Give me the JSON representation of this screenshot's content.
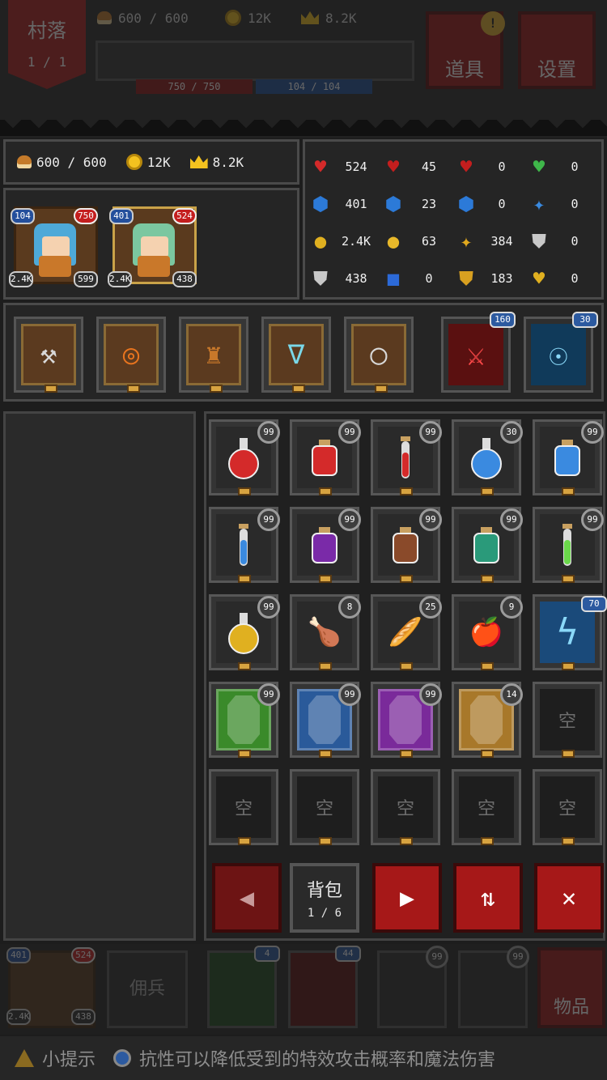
{
  "hud": {
    "location": "村落",
    "location_page": "1 / 1",
    "food": "600 / 600",
    "gold": "12K",
    "fame": "8.2K",
    "hp": "750 / 750",
    "mp": "104 / 104",
    "items_button": "道具",
    "settings_button": "设置",
    "alert_mark": "!"
  },
  "resources": {
    "food": "600 / 600",
    "gold": "12K",
    "fame": "8.2K"
  },
  "heroes": [
    {
      "mp": "104",
      "hp": "750",
      "attack": "2.4K",
      "defense": "599"
    },
    {
      "mp": "401",
      "hp": "524",
      "attack": "2.4K",
      "defense": "438"
    }
  ],
  "stats": [
    {
      "icon": "max-hp-icon",
      "glyph": "♥",
      "color": "#d42a2a",
      "value": "524"
    },
    {
      "icon": "heart-plus-icon",
      "glyph": "♥",
      "color": "#c41e1e",
      "value": "45"
    },
    {
      "icon": "heart-s-icon",
      "glyph": "♥",
      "color": "#c41e1e",
      "value": "0"
    },
    {
      "icon": "green-heart-icon",
      "glyph": "♥",
      "color": "#3fb64a",
      "value": "0"
    },
    {
      "icon": "max-mp-icon",
      "glyph": "⬢",
      "color": "#2c7ad8",
      "value": "401"
    },
    {
      "icon": "mana-plus-icon",
      "glyph": "⬢",
      "color": "#2c7ad8",
      "value": "23"
    },
    {
      "icon": "mana-s-icon",
      "glyph": "⬢",
      "color": "#2c7ad8",
      "value": "0"
    },
    {
      "icon": "blue-star-icon",
      "glyph": "✦",
      "color": "#3a8ae0",
      "value": "0"
    },
    {
      "icon": "attack-potion-icon",
      "glyph": "●",
      "color": "#e0b020",
      "value": "2.4K"
    },
    {
      "icon": "gold-orb-icon",
      "glyph": "●",
      "color": "#e8b82a",
      "value": "63"
    },
    {
      "icon": "gold-star-icon",
      "glyph": "✦",
      "color": "#e0a81e",
      "value": "384"
    },
    {
      "icon": "silver-shield-icon",
      "glyph": "⛊",
      "color": "#c8c8c8",
      "value": "0"
    },
    {
      "icon": "armor-icon",
      "glyph": "⛊",
      "color": "#c8c8c8",
      "value": "438"
    },
    {
      "icon": "blue-gem-icon",
      "glyph": "■",
      "color": "#2c6ad8",
      "value": "0"
    },
    {
      "icon": "gold-shield-icon",
      "glyph": "⛊",
      "color": "#d8a020",
      "value": "183"
    },
    {
      "icon": "gold-heart-badge-icon",
      "glyph": "♥",
      "color": "#e0b020",
      "value": "0"
    }
  ],
  "equipment": [
    {
      "name": "pickaxe-icon",
      "glyph": "⚒",
      "color": "#d8d8d8"
    },
    {
      "name": "round-shield-icon",
      "glyph": "◎",
      "color": "#e8741e"
    },
    {
      "name": "armor-cape-icon",
      "glyph": "♜",
      "color": "#c8782a"
    },
    {
      "name": "necklace-icon",
      "glyph": "∇",
      "color": "#7ad8e8"
    },
    {
      "name": "ring-icon",
      "glyph": "◯",
      "color": "#d8d8d8"
    }
  ],
  "skills": [
    {
      "name": "crossed-swords-skill-icon",
      "glyph": "⚔",
      "color": "#ff4a4a",
      "bg": "#5a1010",
      "level": "160"
    },
    {
      "name": "aura-skill-icon",
      "glyph": "☉",
      "color": "#8ad8f8",
      "bg": "#103a5a",
      "level": "30"
    }
  ],
  "inventory": [
    [
      {
        "name": "red-round-flask-icon",
        "kind": "flask",
        "color": "#d42a2a",
        "count": "99"
      },
      {
        "name": "red-bottle-icon",
        "kind": "bottle",
        "color": "#d42a2a",
        "count": "99"
      },
      {
        "name": "red-vial-icon",
        "kind": "vial",
        "color": "#d42a2a",
        "count": "99"
      },
      {
        "name": "blue-round-flask-icon",
        "kind": "flask",
        "color": "#3a8ae0",
        "count": "30"
      },
      {
        "name": "blue-bottle-icon",
        "kind": "bottle",
        "color": "#3a8ae0",
        "count": "99"
      }
    ],
    [
      {
        "name": "blue-vial-icon",
        "kind": "vial",
        "color": "#3a8ae0",
        "count": "99"
      },
      {
        "name": "purple-bottle-icon",
        "kind": "bottle",
        "color": "#7a2aa8",
        "count": "99"
      },
      {
        "name": "brown-bottle-icon",
        "kind": "bottle",
        "color": "#8a4a2a",
        "count": "99"
      },
      {
        "name": "teal-bottle-icon",
        "kind": "bottle",
        "color": "#2a9a7a",
        "count": "99"
      },
      {
        "name": "green-vial-icon",
        "kind": "vial",
        "color": "#6ad84a",
        "count": "99"
      }
    ],
    [
      {
        "name": "yellow-round-flask-icon",
        "kind": "flask",
        "color": "#e0b020",
        "count": "99"
      },
      {
        "name": "drumstick-icon",
        "kind": "glyph",
        "glyph": "🍗",
        "color": "#c8782a",
        "count": "8"
      },
      {
        "name": "bread-icon",
        "kind": "glyph",
        "glyph": "🥖",
        "color": "#d8903a",
        "count": "25"
      },
      {
        "name": "apple-icon",
        "kind": "glyph",
        "glyph": "🍎",
        "color": "#d42a2a",
        "count": "9"
      },
      {
        "name": "lightning-skill-book-icon",
        "kind": "skill",
        "glyph": "ϟ",
        "color": "#8ad8f8",
        "count": "70"
      }
    ],
    [
      {
        "name": "green-gem-icon",
        "kind": "gem",
        "color": "#3a8a2a",
        "count": "99"
      },
      {
        "name": "blue-gem-icon",
        "kind": "gem",
        "color": "#2a5a9a",
        "count": "99"
      },
      {
        "name": "purple-gem-icon",
        "kind": "gem",
        "color": "#7a2a9a",
        "count": "99"
      },
      {
        "name": "amber-gem-icon",
        "kind": "gem",
        "color": "#a8782a",
        "count": "14"
      },
      {
        "name": "empty-slot",
        "kind": "empty",
        "count": ""
      }
    ],
    [
      {
        "name": "empty-slot",
        "kind": "empty",
        "count": ""
      },
      {
        "name": "empty-slot",
        "kind": "empty",
        "count": ""
      },
      {
        "name": "empty-slot",
        "kind": "empty",
        "count": ""
      },
      {
        "name": "empty-slot",
        "kind": "empty",
        "count": ""
      },
      {
        "name": "empty-slot",
        "kind": "empty",
        "count": ""
      }
    ]
  ],
  "empty_label": "空",
  "pager": {
    "label": "背包",
    "page": "1 / 6"
  },
  "buttons": {
    "prev": "◀",
    "next": "▶",
    "sort": "⇅",
    "close": "✕"
  },
  "footer": {
    "hero_mp": "401",
    "hero_hp": "524",
    "hero_atk": "2.4K",
    "hero_def": "438",
    "mercenary_label": "佣兵",
    "skill1_count": "4",
    "skill2_count": "44",
    "item1_count": "99",
    "item2_count": "99",
    "items_label": "物品"
  },
  "tip": {
    "label": "小提示",
    "text": "抗性可以降低受到的特效攻击概率和魔法伤害"
  }
}
